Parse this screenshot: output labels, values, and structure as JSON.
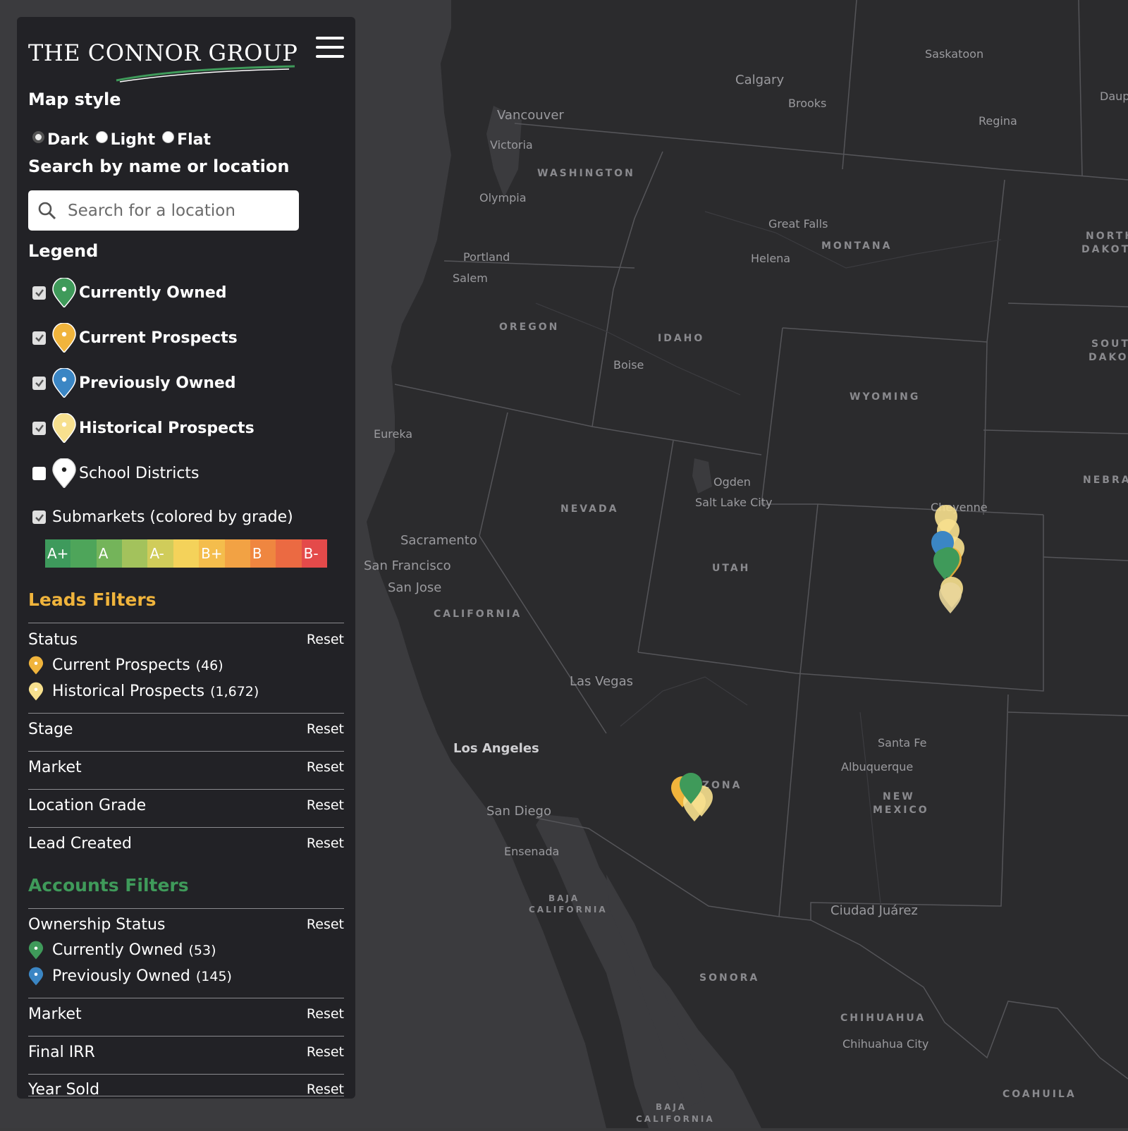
{
  "brand": {
    "logo_text": "THE CONNOR GROUP"
  },
  "map_style": {
    "heading": "Map style",
    "options": [
      {
        "label": "Dark",
        "selected": true
      },
      {
        "label": "Light",
        "selected": false
      },
      {
        "label": "Flat",
        "selected": false
      }
    ]
  },
  "search": {
    "heading": "Search by name or location",
    "placeholder": "Search for a location"
  },
  "legend": {
    "heading": "Legend",
    "items": [
      {
        "label": "Currently Owned",
        "checked": true,
        "color": "#3f9a5a"
      },
      {
        "label": "Current Prospects",
        "checked": true,
        "color": "#f0b43c"
      },
      {
        "label": "Previously Owned",
        "checked": true,
        "color": "#3b86c4"
      },
      {
        "label": "Historical Prospects",
        "checked": true,
        "color": "#f7e08e"
      },
      {
        "label": "School Districts",
        "checked": false,
        "color": "#ffffff"
      }
    ],
    "submarkets": {
      "label": "Submarkets (colored by grade)",
      "checked": true
    },
    "grades": [
      {
        "label": "A+",
        "color": "#3e9a5c"
      },
      {
        "label": "",
        "color": "#4ea55a"
      },
      {
        "label": "A",
        "color": "#74b45a"
      },
      {
        "label": "",
        "color": "#a3c25c"
      },
      {
        "label": "A-",
        "color": "#d0cc5a"
      },
      {
        "label": "",
        "color": "#f4d25a"
      },
      {
        "label": "B+",
        "color": "#f4bd4c"
      },
      {
        "label": "",
        "color": "#f2a244"
      },
      {
        "label": "B",
        "color": "#ef8640"
      },
      {
        "label": "",
        "color": "#eb6a42"
      },
      {
        "label": "B-",
        "color": "#e44a4a"
      }
    ]
  },
  "leads_filters": {
    "heading": "Leads Filters",
    "heading_color": "#f0b43c",
    "status": {
      "label": "Status",
      "reset": "Reset",
      "items": [
        {
          "label": "Current Prospects",
          "count": "(46)",
          "color": "#f0b43c"
        },
        {
          "label": "Historical Prospects",
          "count": "(1,672)",
          "color": "#f7e08e"
        }
      ]
    },
    "rows": [
      {
        "label": "Stage",
        "reset": "Reset"
      },
      {
        "label": "Market",
        "reset": "Reset"
      },
      {
        "label": "Location Grade",
        "reset": "Reset"
      },
      {
        "label": "Lead Created",
        "reset": "Reset"
      }
    ]
  },
  "accounts_filters": {
    "heading": "Accounts Filters",
    "heading_color": "#3f9a5a",
    "ownership": {
      "label": "Ownership Status",
      "reset": "Reset",
      "items": [
        {
          "label": "Currently Owned",
          "count": "(53)",
          "color": "#3f9a5a"
        },
        {
          "label": "Previously Owned",
          "count": "(145)",
          "color": "#3b86c4"
        }
      ]
    },
    "rows": [
      {
        "label": "Market",
        "reset": "Reset"
      },
      {
        "label": "Final IRR",
        "reset": "Reset"
      },
      {
        "label": "Year Sold",
        "reset": "Reset"
      }
    ]
  },
  "map": {
    "labels": {
      "saskatoon": "Saskatoon",
      "calgary": "Calgary",
      "brooks": "Brooks",
      "regina": "Regina",
      "dauph": "Daup",
      "vancouver": "Vancouver",
      "victoria": "Victoria",
      "washington": "WASHINGTON",
      "olympia": "Olympia",
      "great_falls": "Great Falls",
      "montana": "MONTANA",
      "helena": "Helena",
      "north_dakota_1": "NORTH",
      "north_dakota_2": "DAKOTA",
      "portland": "Portland",
      "salem": "Salem",
      "oregon": "OREGON",
      "idaho": "IDAHO",
      "boise": "Boise",
      "south_dakota_1": "SOUTH",
      "south_dakota_2": "DAKOTA",
      "wyoming": "WYOMING",
      "eureka": "Eureka",
      "ogden": "Ogden",
      "salt_lake": "Salt Lake City",
      "nevada": "NEVADA",
      "nebraska": "NEBRAS",
      "cheyenne": "Cheyenne",
      "sacramento": "Sacramento",
      "san_francisco": "San Francisco",
      "san_jose": "San Jose",
      "utah": "UTAH",
      "california": "CALIFORNIA",
      "las_vegas": "Las Vegas",
      "santa_fe": "Santa Fe",
      "los_angeles": "Los Angeles",
      "albuquerque": "Albuquerque",
      "arizona": "ARIZONA",
      "new_mexico_1": "NEW",
      "new_mexico_2": "MEXICO",
      "san_diego": "San Diego",
      "ensenada": "Ensenada",
      "baja_1": "BAJA",
      "baja_2": "CALIFORNIA",
      "ciudad_juarez": "Ciudad Juárez",
      "sonora": "SONORA",
      "chihuahua": "CHIHUAHUA",
      "chihuahua_city": "Chihuahua City",
      "coahuila": "COAHUILA",
      "baja_sur_1": "BAJA",
      "baja_sur_2": "CALIFORNIA"
    }
  }
}
